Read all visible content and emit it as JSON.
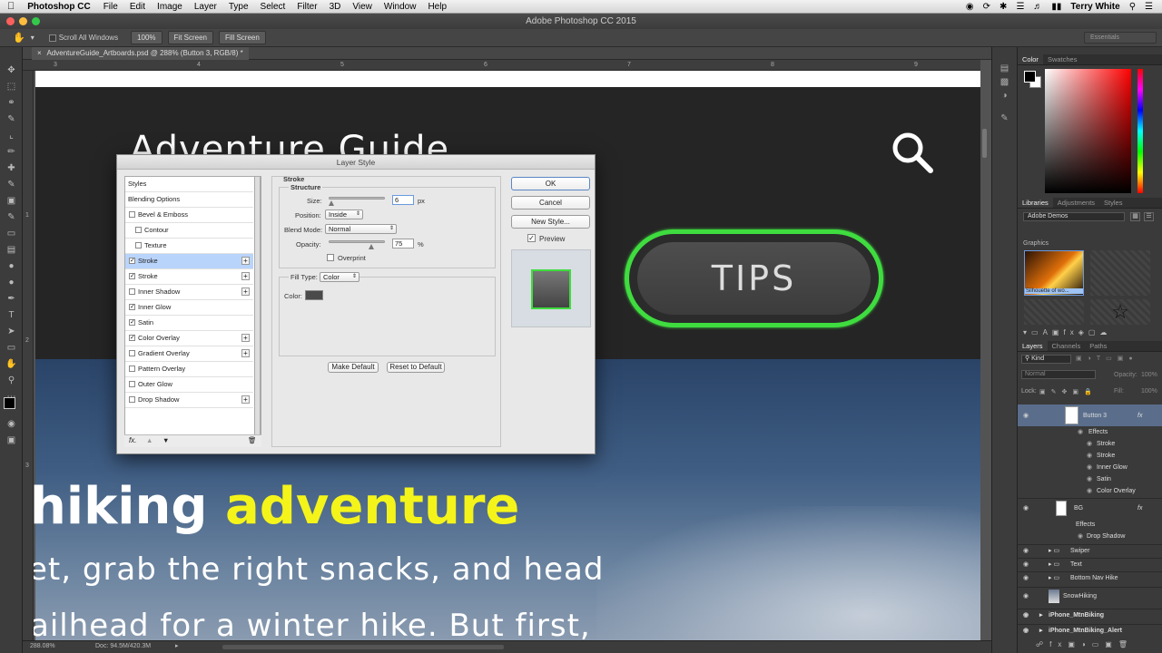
{
  "menubar": {
    "app": "Photoshop CC",
    "items": [
      "File",
      "Edit",
      "Image",
      "Layer",
      "Type",
      "Select",
      "Filter",
      "3D",
      "View",
      "Window",
      "Help"
    ],
    "user": "Terry White"
  },
  "titlebar": {
    "title": "Adobe Photoshop CC 2015"
  },
  "options": {
    "scroll_all": "Scroll All Windows",
    "zoom100": "100%",
    "fit_screen": "Fit Screen",
    "fill_screen": "Fill Screen",
    "workspace": "Essentials"
  },
  "document": {
    "tab": "AdventureGuide_Artboards.psd @ 288% (Button 3, RGB/8) *",
    "ruler_top": [
      "3",
      "4",
      "5",
      "6",
      "7",
      "8",
      "9"
    ],
    "ruler_left": [
      "1",
      "2",
      "3"
    ]
  },
  "artwork": {
    "title": "Adventure Guide",
    "tips_label": "TIPS",
    "line1_a": "hiking ",
    "line1_b": "adventure",
    "line2": "et, grab the right snacks, and head",
    "line3": "ailhead for a winter hike. But first,"
  },
  "status": {
    "zoom": "288.08%",
    "doc": "Doc: 94.5M/420.3M"
  },
  "panels": {
    "color_tabs": [
      "Color",
      "Swatches"
    ],
    "lib_tabs": [
      "Libraries",
      "Adjustments",
      "Styles"
    ],
    "library_name": "Adobe Demos",
    "graphics_label": "Graphics",
    "graphic_caption": "Silhouette of wo...",
    "layer_tabs": [
      "Layers",
      "Channels",
      "Paths"
    ],
    "kind": "Kind",
    "blend": "Normal",
    "opacity_label": "Opacity:",
    "opacity_value": "100%",
    "lock_label": "Lock:",
    "fill_label": "Fill:",
    "fill_value": "100%",
    "layers": [
      {
        "name": "Button 3",
        "fx": "fx"
      },
      {
        "name": "Effects"
      },
      {
        "name": "Stroke"
      },
      {
        "name": "Stroke"
      },
      {
        "name": "Inner Glow"
      },
      {
        "name": "Satin"
      },
      {
        "name": "Color Overlay"
      },
      {
        "name": "BG",
        "fx": "fx"
      },
      {
        "name": "Effects"
      },
      {
        "name": "Drop Shadow"
      },
      {
        "name": "Swiper"
      },
      {
        "name": "Text"
      },
      {
        "name": "Bottom Nav Hike"
      },
      {
        "name": "SnowHiking"
      },
      {
        "name": "iPhone_MtnBiking"
      },
      {
        "name": "iPhone_MtnBiking_Alert"
      }
    ]
  },
  "dialog": {
    "title": "Layer Style",
    "styles_header": "Styles",
    "blending_options": "Blending Options",
    "style_items": [
      {
        "label": "Bevel & Emboss",
        "checked": false,
        "plus": false,
        "indent": false
      },
      {
        "label": "Contour",
        "checked": false,
        "plus": false,
        "indent": true
      },
      {
        "label": "Texture",
        "checked": false,
        "plus": false,
        "indent": true
      },
      {
        "label": "Stroke",
        "checked": true,
        "plus": true,
        "indent": false,
        "selected": true
      },
      {
        "label": "Stroke",
        "checked": true,
        "plus": true,
        "indent": false
      },
      {
        "label": "Inner Shadow",
        "checked": false,
        "plus": true,
        "indent": false
      },
      {
        "label": "Inner Glow",
        "checked": true,
        "plus": false,
        "indent": false
      },
      {
        "label": "Satin",
        "checked": true,
        "plus": false,
        "indent": false
      },
      {
        "label": "Color Overlay",
        "checked": true,
        "plus": true,
        "indent": false
      },
      {
        "label": "Gradient Overlay",
        "checked": false,
        "plus": true,
        "indent": false
      },
      {
        "label": "Pattern Overlay",
        "checked": false,
        "plus": false,
        "indent": false
      },
      {
        "label": "Outer Glow",
        "checked": false,
        "plus": false,
        "indent": false
      },
      {
        "label": "Drop Shadow",
        "checked": false,
        "plus": true,
        "indent": false
      }
    ],
    "section": "Stroke",
    "structure": "Structure",
    "size_label": "Size:",
    "size_value": "6",
    "size_unit": "px",
    "position_label": "Position:",
    "position_value": "Inside",
    "blend_label": "Blend Mode:",
    "blend_value": "Normal",
    "opacity_label": "Opacity:",
    "opacity_value": "75",
    "opacity_unit": "%",
    "overprint": "Overprint",
    "fill_type_label": "Fill Type:",
    "fill_type_value": "Color",
    "color_label": "Color:",
    "stroke_color": "#4a4a4a",
    "make_default": "Make Default",
    "reset_default": "Reset to Default",
    "ok": "OK",
    "cancel": "Cancel",
    "new_style": "New Style...",
    "preview": "Preview"
  },
  "colors": {
    "accent_green": "#3fdc3f",
    "highlight_yellow": "#f4f41a"
  }
}
